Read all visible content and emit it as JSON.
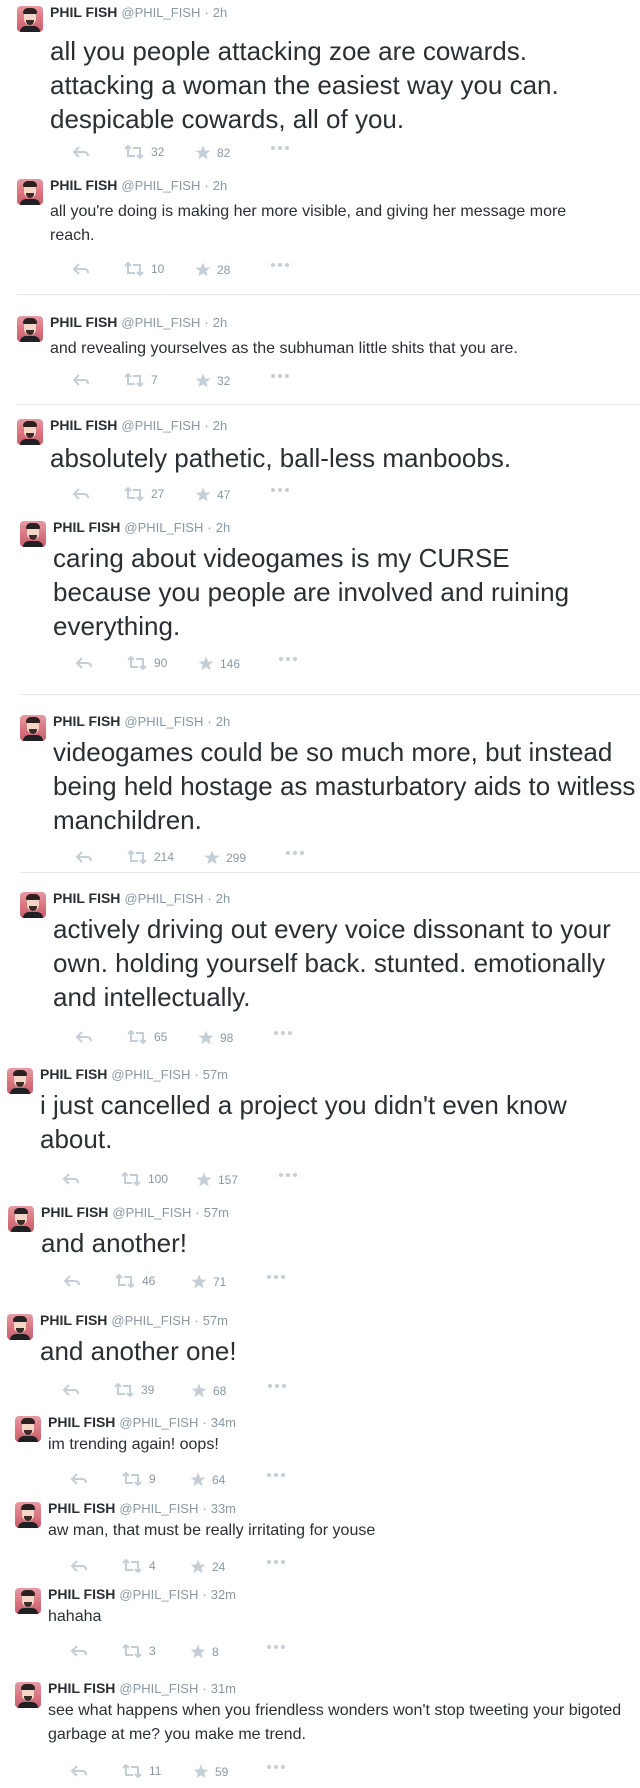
{
  "tweets": [
    {
      "name": "PHIL FISH",
      "handle": "@PHIL_FISH",
      "time": "2h",
      "text": "all you people attacking zoe are cowards. attacking a woman the easiest way you can. despicable cowards, all of you.",
      "retweets": "32",
      "favorites": "82"
    },
    {
      "name": "PHIL FISH",
      "handle": "@PHIL_FISH",
      "time": "2h",
      "text": "all you're doing is making her more visible, and giving her message more reach.",
      "retweets": "10",
      "favorites": "28"
    },
    {
      "name": "PHIL FISH",
      "handle": "@PHIL_FISH",
      "time": "2h",
      "text": "and revealing yourselves as the subhuman little shits that you are.",
      "retweets": "7",
      "favorites": "32"
    },
    {
      "name": "PHIL FISH",
      "handle": "@PHIL_FISH",
      "time": "2h",
      "text": "absolutely pathetic, ball-less manboobs.",
      "retweets": "27",
      "favorites": "47"
    },
    {
      "name": "PHIL FISH",
      "handle": "@PHIL_FISH",
      "time": "2h",
      "text": "caring about videogames is my CURSE because you people are involved and ruining everything.",
      "retweets": "90",
      "favorites": "146"
    },
    {
      "name": "PHIL FISH",
      "handle": "@PHIL_FISH",
      "time": "2h",
      "text": "videogames could be so much more, but instead being held hostage as masturbatory aids to witless manchildren.",
      "retweets": "214",
      "favorites": "299"
    },
    {
      "name": "PHIL FISH",
      "handle": "@PHIL_FISH",
      "time": "2h",
      "text": "actively driving out every voice dissonant to your own. holding yourself back. stunted. emotionally and intellectually.",
      "retweets": "65",
      "favorites": "98"
    },
    {
      "name": "PHIL FISH",
      "handle": "@PHIL_FISH",
      "time": "57m",
      "text": "i just cancelled a project you didn't even know about.",
      "retweets": "100",
      "favorites": "157"
    },
    {
      "name": "PHIL FISH",
      "handle": "@PHIL_FISH",
      "time": "57m",
      "text": "and another!",
      "retweets": "46",
      "favorites": "71"
    },
    {
      "name": "PHIL FISH",
      "handle": "@PHIL_FISH",
      "time": "57m",
      "text": "and another one!",
      "retweets": "39",
      "favorites": "68"
    },
    {
      "name": "PHIL FISH",
      "handle": "@PHIL_FISH",
      "time": "34m",
      "text": "im trending again! oops!",
      "retweets": "9",
      "favorites": "64"
    },
    {
      "name": "PHIL FISH",
      "handle": "@PHIL_FISH",
      "time": "33m",
      "text": "aw man, that must be really irritating for youse",
      "retweets": "4",
      "favorites": "24"
    },
    {
      "name": "PHIL FISH",
      "handle": "@PHIL_FISH",
      "time": "32m",
      "text": "hahaha",
      "retweets": "3",
      "favorites": "8"
    },
    {
      "name": "PHIL FISH",
      "handle": "@PHIL_FISH",
      "time": "31m",
      "text": "see what happens when you friendless wonders won't stop tweeting your bigoted garbage at me? you make me trend.",
      "retweets": "11",
      "favorites": "59"
    }
  ]
}
